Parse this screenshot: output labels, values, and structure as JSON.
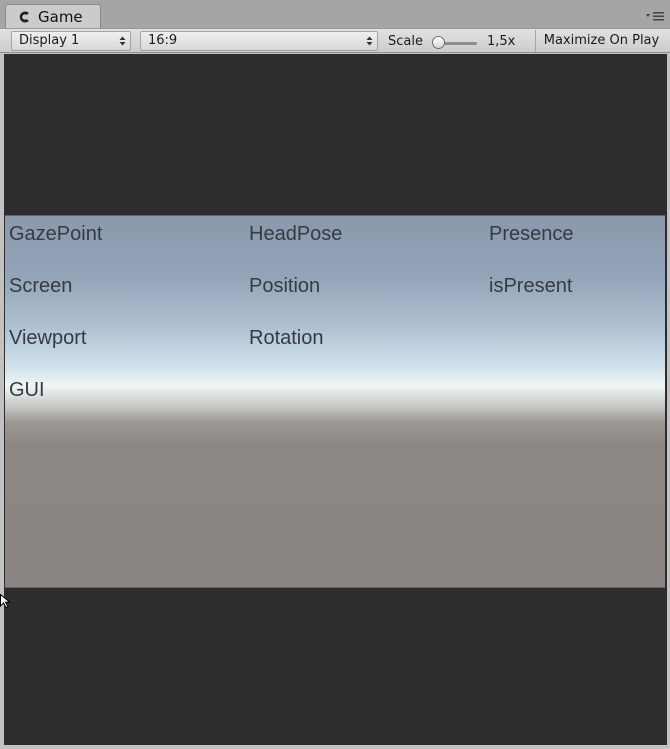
{
  "tab": {
    "title": "Game",
    "icon": "game-view-icon"
  },
  "toolbar": {
    "display_value": "Display 1",
    "aspect_value": "16:9",
    "scale_label": "Scale",
    "scale_value": "1,5x",
    "maximize_label": "Maximize On Play"
  },
  "scene": {
    "columns": [
      {
        "header": "GazePoint",
        "items": [
          "Screen",
          "Viewport",
          "GUI"
        ]
      },
      {
        "header": "HeadPose",
        "items": [
          "Position",
          "Rotation"
        ]
      },
      {
        "header": "Presence",
        "items": [
          "isPresent"
        ]
      }
    ]
  },
  "colors": {
    "editor_background": "#c2c2c2",
    "letterbox": "#2d2d2d",
    "sky_top": "#8b98ac",
    "horizon": "#eef7f6",
    "ground": "#8b8683",
    "label_text": "#363a42"
  }
}
